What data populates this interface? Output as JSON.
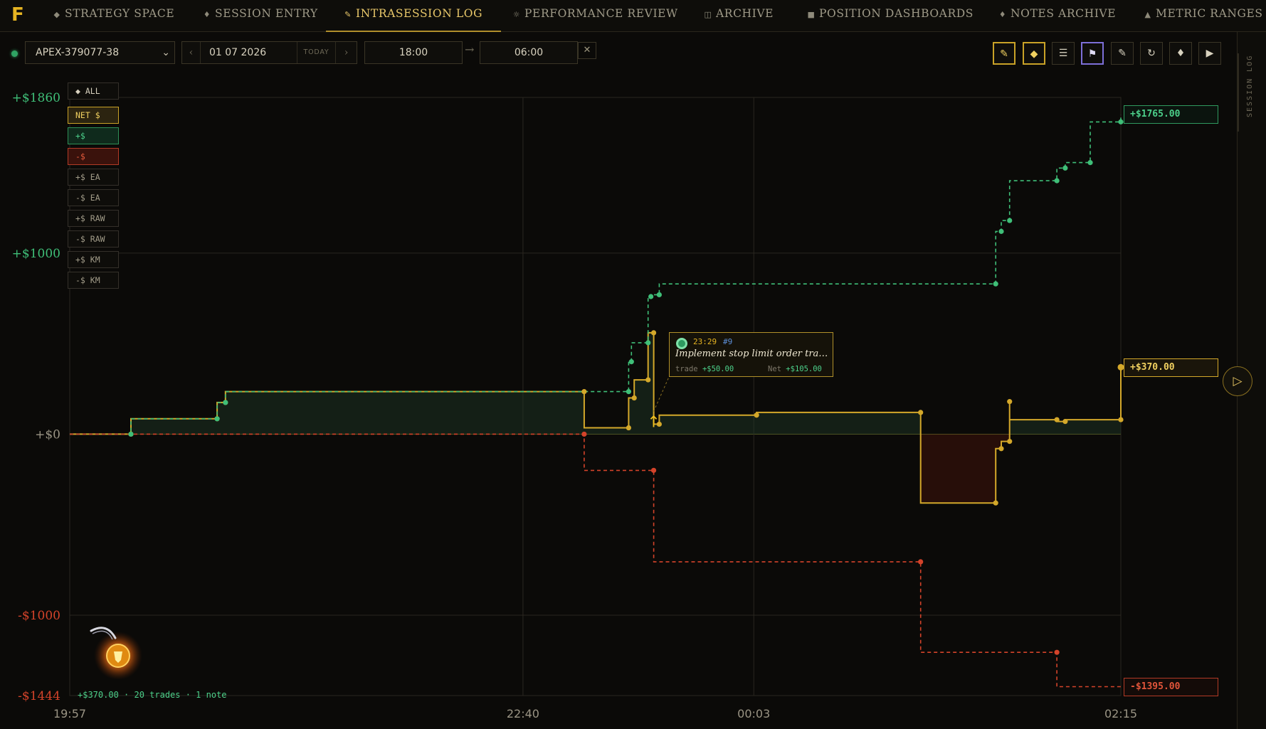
{
  "nav": {
    "logo": "F",
    "tabs": [
      {
        "label": "STRATEGY SPACE",
        "icon": "◆"
      },
      {
        "label": "SESSION ENTRY",
        "icon": "♦"
      },
      {
        "label": "INTRASESSION LOG",
        "icon": "✎",
        "active": true
      },
      {
        "label": "PERFORMANCE REVIEW",
        "icon": "☼"
      },
      {
        "label": "ARCHIVE",
        "icon": "◫"
      },
      {
        "label": "POSITION DASHBOARDS",
        "icon": "■"
      },
      {
        "label": "NOTES ARCHIVE",
        "icon": "♦"
      },
      {
        "label": "METRIC RANGES",
        "icon": "▲"
      }
    ]
  },
  "rail": {
    "label": "SESSION LOG"
  },
  "toolbar": {
    "account": "APEX-379077-38",
    "date": "01 07 2026",
    "today_label": "TODAY",
    "prev_glyph": "‹",
    "next_glyph": "›",
    "time_start": "18:00",
    "time_arrow": "→",
    "time_end": "06:00",
    "clear_glyph": "✕",
    "tools": [
      {
        "icon": "✎",
        "name": "pencil-icon",
        "state": "on"
      },
      {
        "icon": "◆",
        "name": "diamond-icon",
        "state": "on"
      },
      {
        "icon": "☰",
        "name": "list-icon",
        "state": "off"
      },
      {
        "icon": "⚑",
        "name": "flag-icon",
        "state": "flag"
      },
      {
        "icon": "✎",
        "name": "ruler-icon",
        "state": "off"
      },
      {
        "icon": "↻",
        "name": "refresh-icon",
        "state": "off"
      },
      {
        "icon": "♦",
        "name": "marker-icon",
        "state": "off"
      },
      {
        "icon": "▶",
        "name": "play-icon",
        "state": "off"
      }
    ]
  },
  "legend": [
    {
      "label": "◆ ALL",
      "style": "all"
    },
    {
      "label": "NET $",
      "style": "net"
    },
    {
      "label": "+$",
      "style": "pos"
    },
    {
      "label": "-$",
      "style": "neg"
    },
    {
      "label": "+$ EA",
      "style": "plain"
    },
    {
      "label": "-$ EA",
      "style": "plain"
    },
    {
      "label": "+$ RAW",
      "style": "plain"
    },
    {
      "label": "-$ RAW",
      "style": "plain"
    },
    {
      "label": "+$ KM",
      "style": "plain"
    },
    {
      "label": "-$ KM",
      "style": "plain"
    }
  ],
  "colors": {
    "net": "#d4a82a",
    "positive": "#3fbf78",
    "negative": "#d4432a",
    "grid": "#2a2720",
    "zero_line": "#5a5a22"
  },
  "value_tags": {
    "positive": "+$1765.00",
    "net": "+$370.00",
    "negative": "-$1395.00"
  },
  "tooltip": {
    "time": "23:29",
    "id": "#9",
    "text": "Implement stop limit order tra…",
    "trade_label": "trade",
    "trade_value": "+$50.00",
    "net_label": "Net",
    "net_value": "+$105.00"
  },
  "summary": "+$370.00 · 20 trades · 1 note",
  "side_toggle_glyph": "▷",
  "chart_data": {
    "type": "line",
    "y_ticks": [
      {
        "label": "+$1860",
        "value": 1860
      },
      {
        "label": "+$1000",
        "value": 1000
      },
      {
        "label": "+$0",
        "value": 0
      },
      {
        "label": "-$1000",
        "value": -1000
      },
      {
        "label": "-$1444",
        "value": -1444
      }
    ],
    "x_ticks": [
      {
        "label": "19:57",
        "value": 1197
      },
      {
        "label": "22:40",
        "value": 1360
      },
      {
        "label": "00:03",
        "value": 1443
      },
      {
        "label": "02:15",
        "value": 1575
      }
    ],
    "ylim": [
      -1444,
      1860
    ],
    "xlim": [
      1197,
      1575
    ],
    "series": [
      {
        "name": "NET $",
        "style": "solid-step",
        "points": [
          [
            1197,
            0
          ],
          [
            1219,
            0
          ],
          [
            1219,
            85
          ],
          [
            1250,
            85
          ],
          [
            1250,
            175
          ],
          [
            1253,
            175
          ],
          [
            1253,
            235
          ],
          [
            1382,
            235
          ],
          [
            1382,
            35
          ],
          [
            1398,
            35
          ],
          [
            1398,
            200
          ],
          [
            1400,
            200
          ],
          [
            1400,
            300
          ],
          [
            1405,
            300
          ],
          [
            1405,
            560
          ],
          [
            1407,
            560
          ],
          [
            1407,
            55
          ],
          [
            1409,
            55
          ],
          [
            1409,
            105
          ],
          [
            1444,
            105
          ],
          [
            1444,
            120
          ],
          [
            1503,
            120
          ],
          [
            1503,
            -380
          ],
          [
            1530,
            -380
          ],
          [
            1530,
            -80
          ],
          [
            1532,
            -80
          ],
          [
            1532,
            -40
          ],
          [
            1535,
            -40
          ],
          [
            1535,
            180
          ],
          [
            1535,
            80
          ],
          [
            1552,
            80
          ],
          [
            1552,
            70
          ],
          [
            1555,
            70
          ],
          [
            1555,
            80
          ],
          [
            1575,
            80
          ],
          [
            1575,
            370
          ]
        ]
      },
      {
        "name": "+$",
        "style": "dashed-step",
        "points": [
          [
            1197,
            0
          ],
          [
            1219,
            0
          ],
          [
            1219,
            85
          ],
          [
            1250,
            85
          ],
          [
            1250,
            175
          ],
          [
            1253,
            175
          ],
          [
            1253,
            235
          ],
          [
            1382,
            235
          ],
          [
            1398,
            235
          ],
          [
            1398,
            400
          ],
          [
            1399,
            400
          ],
          [
            1399,
            505
          ],
          [
            1405,
            505
          ],
          [
            1405,
            760
          ],
          [
            1406,
            760
          ],
          [
            1406,
            770
          ],
          [
            1409,
            770
          ],
          [
            1409,
            830
          ],
          [
            1444,
            830
          ],
          [
            1503,
            830
          ],
          [
            1530,
            830
          ],
          [
            1530,
            1120
          ],
          [
            1532,
            1120
          ],
          [
            1532,
            1180
          ],
          [
            1535,
            1180
          ],
          [
            1535,
            1400
          ],
          [
            1552,
            1400
          ],
          [
            1552,
            1470
          ],
          [
            1555,
            1470
          ],
          [
            1555,
            1500
          ],
          [
            1564,
            1500
          ],
          [
            1564,
            1725
          ],
          [
            1575,
            1725
          ],
          [
            1575,
            1765
          ]
        ]
      },
      {
        "name": "-$",
        "style": "dashed-step",
        "points": [
          [
            1197,
            0
          ],
          [
            1219,
            0
          ],
          [
            1250,
            0
          ],
          [
            1253,
            0
          ],
          [
            1382,
            0
          ],
          [
            1382,
            -200
          ],
          [
            1398,
            -200
          ],
          [
            1399,
            -200
          ],
          [
            1407,
            -200
          ],
          [
            1407,
            -705
          ],
          [
            1444,
            -705
          ],
          [
            1503,
            -705
          ],
          [
            1503,
            -1205
          ],
          [
            1530,
            -1205
          ],
          [
            1532,
            -1205
          ],
          [
            1535,
            -1205
          ],
          [
            1552,
            -1205
          ],
          [
            1552,
            -1395
          ],
          [
            1555,
            -1395
          ],
          [
            1564,
            -1395
          ],
          [
            1575,
            -1395
          ]
        ]
      }
    ]
  }
}
